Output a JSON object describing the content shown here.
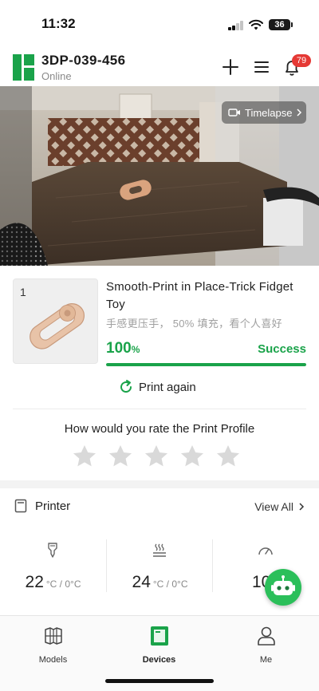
{
  "status_bar": {
    "time": "11:32",
    "battery": "36"
  },
  "header": {
    "device_name": "3DP-039-456",
    "device_status": "Online",
    "notification_count": "79"
  },
  "camera": {
    "timelapse_label": "Timelapse"
  },
  "job": {
    "plate_number": "1",
    "title": "Smooth-Print in Place-Trick Fidget Toy",
    "subtitle": "手感更压手， 50% 填充，看个人喜好",
    "progress_value": "100",
    "progress_unit": "%",
    "progress_fraction": 1.0,
    "status": "Success",
    "print_again_label": "Print again"
  },
  "rating": {
    "prompt": "How would you rate the Print Profile",
    "stars_total": 5,
    "stars_selected": 0
  },
  "printer": {
    "section_title": "Printer",
    "view_all_label": "View All",
    "temps": [
      {
        "icon": "nozzle-temp-icon",
        "value": "22",
        "unit": "°C / 0°C"
      },
      {
        "icon": "bed-temp-icon",
        "value": "24",
        "unit": "°C / 0°C"
      },
      {
        "icon": "speed-gauge-icon",
        "value": "100",
        "unit": ""
      }
    ]
  },
  "tabs": [
    {
      "label": "Models",
      "icon": "models-cube-icon",
      "active": false
    },
    {
      "label": "Devices",
      "icon": "printer-device-icon",
      "active": true
    },
    {
      "label": "Me",
      "icon": "user-profile-icon",
      "active": false
    }
  ],
  "colors": {
    "brand_green": "#1aa34a",
    "badge_red": "#e53935",
    "assistant_green": "#2bbf5a"
  }
}
